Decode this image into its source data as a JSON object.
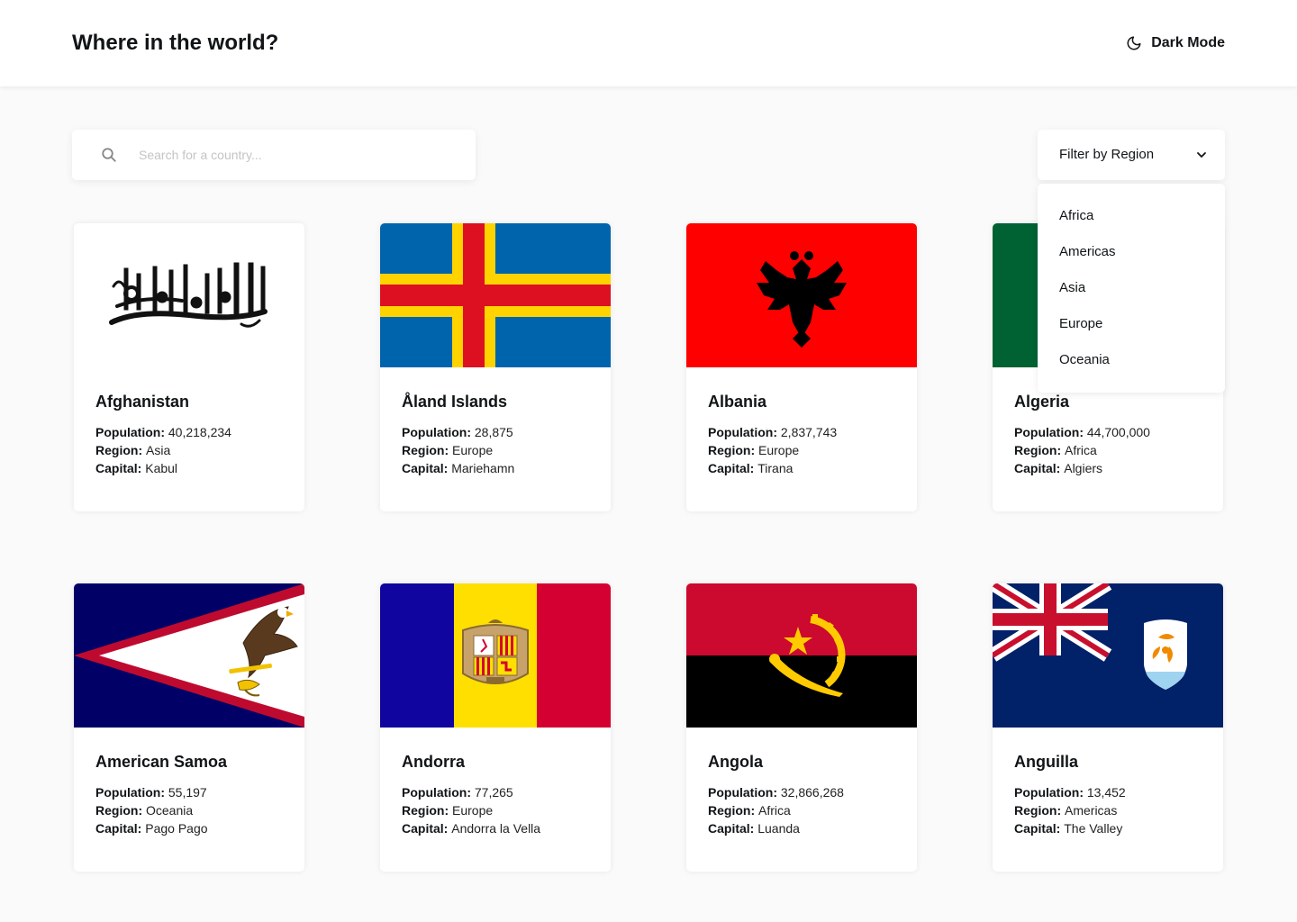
{
  "header": {
    "title": "Where in the world?",
    "theme_toggle_label": "Dark Mode",
    "theme_icon": "moon-icon"
  },
  "search": {
    "placeholder": "Search for a country...",
    "value": "",
    "icon": "search-icon"
  },
  "filter": {
    "label": "Filter by Region",
    "icon": "chevron-down-icon",
    "options": [
      "Africa",
      "Americas",
      "Asia",
      "Europe",
      "Oceania"
    ]
  },
  "labels": {
    "population": "Population:",
    "region": "Region:",
    "capital": "Capital:"
  },
  "countries": [
    {
      "name": "Afghanistan",
      "population": "40,218,234",
      "region": "Asia",
      "capital": "Kabul",
      "flag": "flag-afghanistan"
    },
    {
      "name": "Åland Islands",
      "population": "28,875",
      "region": "Europe",
      "capital": "Mariehamn",
      "flag": "flag-aland-islands"
    },
    {
      "name": "Albania",
      "population": "2,837,743",
      "region": "Europe",
      "capital": "Tirana",
      "flag": "flag-albania"
    },
    {
      "name": "Algeria",
      "population": "44,700,000",
      "region": "Africa",
      "capital": "Algiers",
      "flag": "flag-algeria"
    },
    {
      "name": "American Samoa",
      "population": "55,197",
      "region": "Oceania",
      "capital": "Pago Pago",
      "flag": "flag-american-samoa"
    },
    {
      "name": "Andorra",
      "population": "77,265",
      "region": "Europe",
      "capital": "Andorra la Vella",
      "flag": "flag-andorra"
    },
    {
      "name": "Angola",
      "population": "32,866,268",
      "region": "Africa",
      "capital": "Luanda",
      "flag": "flag-angola"
    },
    {
      "name": "Anguilla",
      "population": "13,452",
      "region": "Americas",
      "capital": "The Valley",
      "flag": "flag-anguilla"
    }
  ],
  "colors": {
    "background": "#fafafa",
    "surface": "#ffffff",
    "text": "#111517",
    "placeholder": "#c4c4c4"
  }
}
